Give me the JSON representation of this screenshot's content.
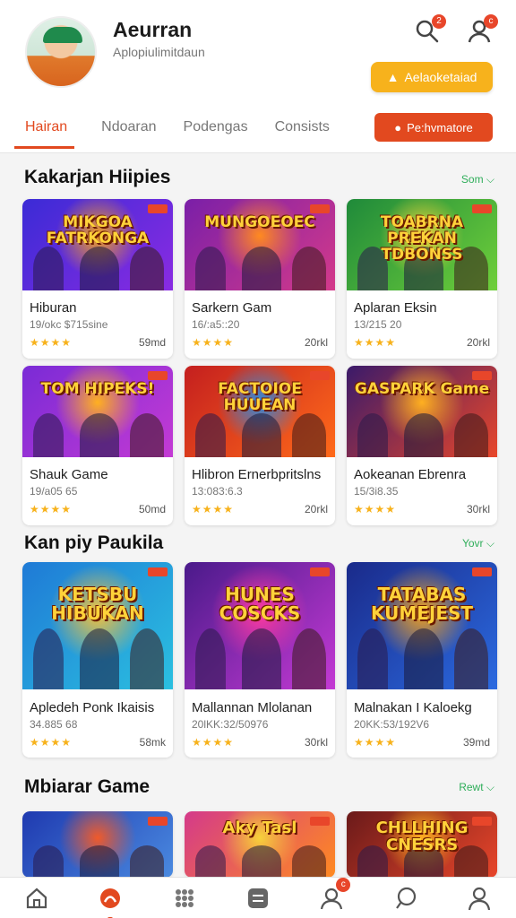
{
  "profile": {
    "name": "Aeurran",
    "subtitle": "Aplopiulimitdaun",
    "notif_count": "2",
    "friend_count": "c"
  },
  "buttons": {
    "primary": "Aelaoketaiad",
    "secondary": "Pe:hvmatore"
  },
  "tabs": [
    {
      "label": "Hairan",
      "active": true
    },
    {
      "label": "Ndoaran",
      "active": false
    },
    {
      "label": "Podengas",
      "active": false
    },
    {
      "label": "Consists",
      "active": false
    }
  ],
  "sections": [
    {
      "title": "Kakarjan Hiipies",
      "more": "Som ⌵",
      "games": [
        {
          "name": "Hiburan",
          "meta": "19/okc $715sine",
          "rating": "★★★★",
          "size": "59md",
          "art_title": "MIKGOA FATRKONGA",
          "colors": [
            "#3b2bd6",
            "#8a2be2",
            "#f0a020"
          ]
        },
        {
          "name": "Sarkern Gam",
          "meta": "16/:a5::20",
          "rating": "★★★★",
          "size": "20rkl",
          "art_title": "MUNGOEOEC",
          "colors": [
            "#7a1fa8",
            "#d43a8a",
            "#ff8a20"
          ]
        },
        {
          "name": "Aplaran Eksin",
          "meta": "13/215 20",
          "rating": "★★★★",
          "size": "20rkl",
          "art_title": "TOABRNA PREKAN TDBONSS",
          "colors": [
            "#1f8a3a",
            "#6fcf3a",
            "#f3d23a"
          ]
        }
      ]
    },
    {
      "title": "Kan piy Paukila",
      "more": "Yovr ⌵",
      "games": [
        {
          "name": "Shauk Game",
          "meta": "19/a05 65",
          "rating": "★★★★",
          "size": "50md",
          "art_title": "TOM HIPEKS!",
          "colors": [
            "#7a2bd6",
            "#c43ad4",
            "#ffb020"
          ]
        },
        {
          "name": "Hlibron Ernerbpritslns",
          "meta": "13:083:6.3",
          "rating": "★★★★",
          "size": "20rkl",
          "art_title": "FACTOIOE HUUEAN",
          "colors": [
            "#c41f1f",
            "#ff6a1a",
            "#2b8ae0"
          ]
        },
        {
          "name": "Aokeanan Ebrenra",
          "meta": "15/3i8.35",
          "rating": "★★★★",
          "size": "30rkl",
          "art_title": "GASPARK Game",
          "colors": [
            "#3a1a6a",
            "#e8462a",
            "#ffb020"
          ]
        }
      ]
    },
    {
      "title": "Mbiarar Game",
      "more": "Rewt ⌵",
      "games": [
        {
          "name": "Apledeh Ponk Ikaisis",
          "meta": "34.885 68",
          "rating": "★★★★",
          "size": "58mk",
          "art_title": "KETSBU HIBUKAN",
          "colors": [
            "#1f7ad6",
            "#2bc0e0",
            "#f7c23a"
          ]
        },
        {
          "name": "Mallannan Mlolanan",
          "meta": "20lKK:32/50976",
          "rating": "★★★★",
          "size": "30rkl",
          "art_title": "HUNES COSCKS",
          "colors": [
            "#4a1a8a",
            "#c43ad4",
            "#ff3aa0"
          ]
        },
        {
          "name": "Malnakan I Kaloekg",
          "meta": "20KK:53/192V6",
          "rating": "★★★★",
          "size": "39md",
          "art_title": "TATABAS KUMEJEST",
          "colors": [
            "#1a2a8a",
            "#2b6ae0",
            "#f0a020"
          ]
        }
      ]
    }
  ],
  "featured": [
    {
      "art_title": "",
      "colors": [
        "#1f3ab0",
        "#4a8ae0",
        "#f05a2a"
      ]
    },
    {
      "art_title": "Aky Tasl",
      "colors": [
        "#d43a8a",
        "#ff8a20",
        "#f7d23a"
      ]
    },
    {
      "art_title": "CHLLHING CNESRS",
      "colors": [
        "#6a1a1a",
        "#e8462a",
        "#ffb020"
      ]
    }
  ],
  "bottom_nav": [
    {
      "name": "home-icon",
      "active": false
    },
    {
      "name": "games-icon",
      "active": true
    },
    {
      "name": "grid-icon",
      "active": false
    },
    {
      "name": "store-icon",
      "active": false
    },
    {
      "name": "notifications-icon",
      "active": false,
      "badge": "c"
    },
    {
      "name": "chat-icon",
      "active": false
    },
    {
      "name": "profile-icon",
      "active": false
    }
  ],
  "accent_color": "#e2491f",
  "highlight_color": "#f7b21c"
}
